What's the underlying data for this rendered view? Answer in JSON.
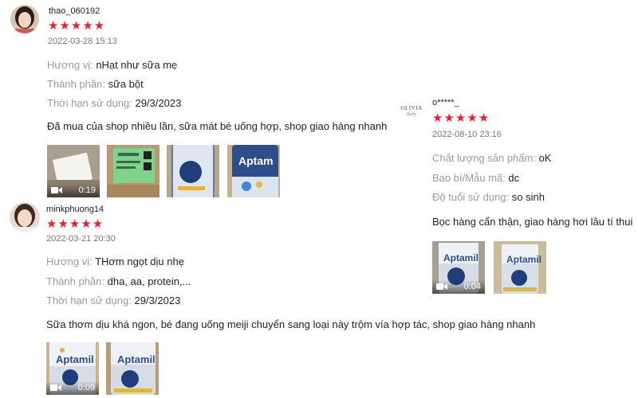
{
  "reviews": [
    {
      "username": "thao_060192",
      "stars": "★★★★★",
      "datetime": "2022-03-28 15:13",
      "fields": [
        {
          "label": "Hương vị: ",
          "value": "nHạt như sữa mẹ"
        },
        {
          "label": "Thành phần: ",
          "value": "sữa bột"
        },
        {
          "label": "Thời hạn sử dụng: ",
          "value": "29/3/2023"
        }
      ],
      "comment": "Đã mua của shop nhiều lần, sữa mát bé uống hợp, shop giao hàng nhanh",
      "media": [
        {
          "type": "video",
          "duration": "0:19",
          "icon": "video-camera-icon"
        },
        {
          "type": "image"
        },
        {
          "type": "image"
        },
        {
          "type": "image",
          "brand_text": "Aptam"
        }
      ]
    },
    {
      "username": "minkphuong14",
      "stars": "★★★★★",
      "datetime": "2022-03-21 20:30",
      "fields": [
        {
          "label": "Hương vị: ",
          "value": "THơm ngọt dịu nhẹ"
        },
        {
          "label": "Thành phần: ",
          "value": "dha, aa, protein,..."
        },
        {
          "label": "Thời hạn sử dụng: ",
          "value": "29/3/2023"
        }
      ],
      "comment": "Sữa thơm dịu khá ngon, bé đang uống meiji chuyển sang loại này trộm vía hợp tác, shop giao hàng nhanh",
      "media": [
        {
          "type": "video",
          "duration": "0:09",
          "brand_text": "Aptamil",
          "icon": "video-camera-icon"
        },
        {
          "type": "image",
          "brand_text": "Aptamil"
        }
      ]
    },
    {
      "username": "o*****_",
      "avatar_text": "OLIVIA",
      "avatar_subtext": "Baby",
      "stars": "★★★★★",
      "datetime": "2022-08-10 23:16",
      "fields": [
        {
          "label": "Chất lượng sản phẩm: ",
          "value": "oK"
        },
        {
          "label": "Bao bì/Mẫu mã: ",
          "value": "dc"
        },
        {
          "label": "Độ tuổi sử dụng: ",
          "value": "so sinh"
        }
      ],
      "comment": "Bọc hàng cẩn thận, giao hàng hơi lâu tí thui",
      "media": [
        {
          "type": "video",
          "duration": "0:04",
          "brand_text": "Aptamil",
          "icon": "video-camera-icon"
        },
        {
          "type": "image",
          "brand_text": "Aptamil"
        }
      ]
    }
  ],
  "colors": {
    "star": "#ee1d2d",
    "label": "#9a9a9a",
    "text": "#222222",
    "datetime": "#757575"
  }
}
